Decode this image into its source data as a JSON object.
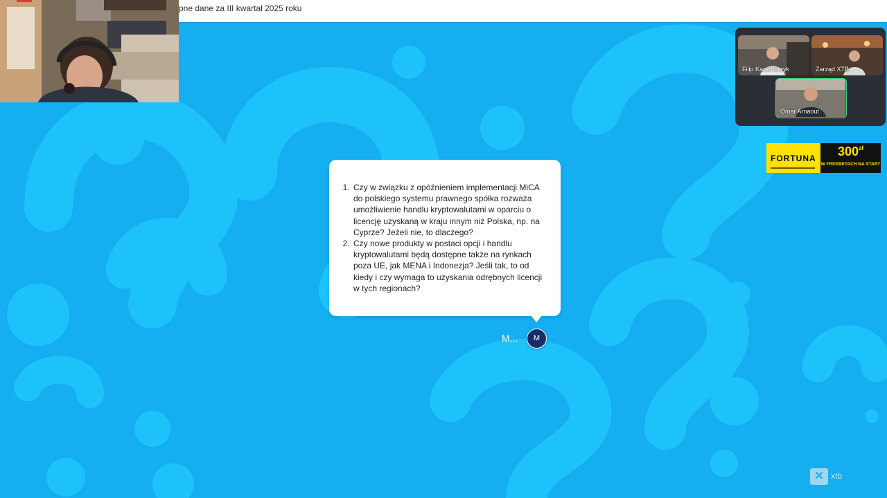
{
  "topbar": {
    "title": "pne dane za III kwartał 2025 roku"
  },
  "webcam": {
    "icon": "presenter-video-feed"
  },
  "participants": [
    {
      "name": "Filip Kaczmarzyk"
    },
    {
      "name": "Zarząd XTB"
    },
    {
      "name": "Omar Arnaout"
    }
  ],
  "ad": {
    "brand": "FORTUNA",
    "amount": "300",
    "currency": "zł",
    "subtitle": "W FREEBETACH NA START",
    "brand_color": "#ffe100"
  },
  "question": {
    "items": [
      "Czy w związku z opóźnieniem implementacji MiCA do polskiego systemu prawnego spółka rozważa umożliwienie handlu kryptowalutami w oparciu o licencję uzyskaną w kraju innym niż Polska, np. na Cyprze? Jeżeli nie, to dlaczego?",
      "Czy nowe produkty w postaci opcji i handlu kryptowalutami będą dostępne także na rynkach poza UE, jak MENA i Indonezja? Jeśli tak, to od kiedy i czy wymaga to uzyskania odrębnych licencji w tych regionach?"
    ],
    "author_name": "M...",
    "author_initial": "M",
    "avatar_color": "#1a2a6c"
  },
  "footer": {
    "logo_mark": "✕",
    "logo_text": "xtb"
  },
  "colors": {
    "background": "#15aef0",
    "pattern": "#1ec2fb"
  }
}
